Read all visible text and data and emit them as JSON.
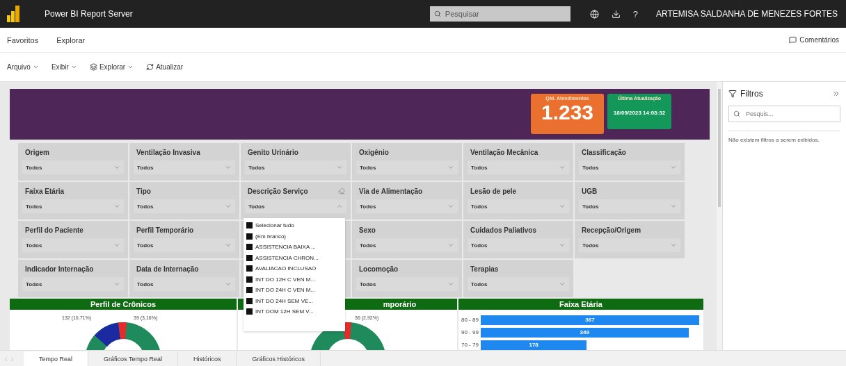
{
  "header": {
    "app_title": "Power BI Report Server",
    "search": {
      "placeholder": "Pesquisar"
    },
    "help": "?",
    "user": "ARTEMISA SALDANHA DE MENEZES FORTES"
  },
  "nav": {
    "items": [
      {
        "label": "Favoritos"
      },
      {
        "label": "Explorar"
      }
    ],
    "comments": "Comentários"
  },
  "toolbar": [
    {
      "label": "Arquivo",
      "kind": "menu"
    },
    {
      "label": "Exibir",
      "kind": "menu"
    },
    {
      "label": "Explorar",
      "kind": "explore"
    },
    {
      "label": "Atualizar",
      "kind": "refresh"
    }
  ],
  "kpis": [
    {
      "kind": "count",
      "title": "Qtd. Atendimentos",
      "value": "1.233",
      "color": "#e9702e"
    },
    {
      "kind": "date",
      "title": "Última Atualização",
      "value": "18/09/2023 14:03:32",
      "color": "#13985a"
    }
  ],
  "slicer_rows": [
    [
      {
        "label": "Origem",
        "value": "Todos",
        "expanded": false
      },
      {
        "label": "Ventilação Invasiva",
        "value": "Todos",
        "expanded": false
      },
      {
        "label": "Genito Urinário",
        "value": "Todos",
        "expanded": false
      },
      {
        "label": "Oxigênio",
        "value": "Todos",
        "expanded": false
      },
      {
        "label": "Ventilação Mecânica",
        "value": "Todos",
        "expanded": false
      },
      {
        "label": "Classificação",
        "value": "Todos",
        "expanded": false
      }
    ],
    [
      {
        "label": "Faixa Etária",
        "value": "Todos",
        "expanded": false
      },
      {
        "label": "Tipo",
        "value": "Todos",
        "expanded": false
      },
      {
        "label": "Descrição Serviço",
        "value": "Todos",
        "expanded": true,
        "options": [
          {
            "label": "Selecionar tudo",
            "checked": true
          },
          {
            "label": "(Em branco)",
            "checked": true
          },
          {
            "label": "ASSISTENCIA BAIXA ...",
            "checked": true
          },
          {
            "label": "ASSISTENCIA CHRON...",
            "checked": true
          },
          {
            "label": "AVALIACAO INCLUSAO",
            "checked": true
          },
          {
            "label": "INT DO 12H C VEN M...",
            "checked": true
          },
          {
            "label": "INT DO 24H C VEN M...",
            "checked": true
          },
          {
            "label": "INT DO 24H SEM VE...",
            "checked": true
          },
          {
            "label": "INT DOM 12H SEM V...",
            "checked": true
          }
        ]
      },
      {
        "label": "Via de Alimentação",
        "value": "Todos",
        "expanded": false
      },
      {
        "label": "Lesão de pele",
        "value": "Todos",
        "expanded": false
      },
      {
        "label": "UGB",
        "value": "Todos",
        "expanded": false
      }
    ],
    [
      {
        "label": "Perfil do Paciente",
        "value": "Todos",
        "expanded": false
      },
      {
        "label": "Perfil Temporário",
        "value": "Todos",
        "expanded": false
      },
      null,
      {
        "label": "Sexo",
        "value": "Todos",
        "expanded": false
      },
      {
        "label": "Cuidados Paliativos",
        "value": "Todos",
        "expanded": false
      },
      {
        "label": "Recepção/Origem",
        "value": "Todos",
        "expanded": false
      }
    ],
    [
      {
        "label": "Indicador Internação",
        "value": "Todos",
        "expanded": false
      },
      {
        "label": "Data de Internação",
        "value": "Todos",
        "expanded": false
      },
      null,
      {
        "label": "Locomoção",
        "value": "Todos",
        "expanded": false
      },
      {
        "label": "Terapias",
        "value": "Todos",
        "expanded": false
      }
    ]
  ],
  "charts": [
    {
      "kind": "donut",
      "title": "Perfil de Crônicos",
      "labels": [
        "132 (10,71%)",
        "39 (3,16%)"
      ]
    },
    {
      "kind": "donut",
      "title": "mporário",
      "labels": [
        "36 (2,92%)"
      ]
    },
    {
      "kind": "bar",
      "title": "Faixa Etária",
      "chart_data": {
        "type": "bar",
        "orientation": "horizontal",
        "categories": [
          "80 - 89",
          "90 - 99",
          "70 - 79"
        ],
        "values": [
          367,
          349,
          178
        ],
        "data_labels": true
      }
    }
  ],
  "filters": {
    "title": "Filtros",
    "search": {
      "placeholder": "Pesquis..."
    },
    "empty_message": "Não existem filtros a serem exibidos."
  },
  "pages": [
    {
      "label": "Tempo Real",
      "selected": true
    },
    {
      "label": "Gráficos Tempo Real",
      "selected": false
    },
    {
      "label": "Históricos",
      "selected": false
    },
    {
      "label": "Gráficos Históricos",
      "selected": false
    }
  ]
}
